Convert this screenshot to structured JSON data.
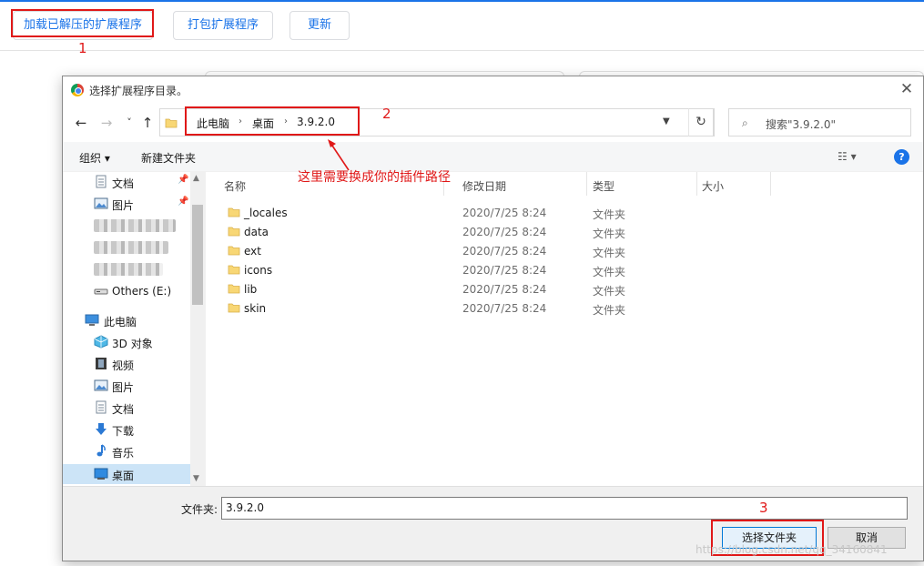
{
  "extensions_toolbar": {
    "load_unpacked": "加载已解压的扩展程序",
    "pack_extension": "打包扩展程序",
    "update": "更新"
  },
  "annotations": {
    "step1": "1",
    "step2": "2",
    "step3": "3",
    "path_note": "这里需要换成你的插件路径"
  },
  "dialog": {
    "title": "选择扩展程序目录。",
    "close": "✕",
    "nav": {
      "back": "←",
      "forward": "→",
      "recent": "˅",
      "up": "↑"
    },
    "breadcrumb": [
      "此电脑",
      "桌面",
      "3.9.2.0"
    ],
    "search_placeholder": "搜索\"3.9.2.0\"",
    "commands": {
      "organize": "组织 ▾",
      "new_folder": "新建文件夹"
    },
    "help": "?"
  },
  "nav_pane": {
    "quick_access": [
      {
        "label": "文档",
        "icon": "document-icon"
      },
      {
        "label": "图片",
        "icon": "picture-icon"
      }
    ],
    "drive": {
      "label": "Others (E:)",
      "icon": "drive-icon"
    },
    "this_pc": {
      "label": "此电脑",
      "icon": "computer-icon"
    },
    "pc_items": [
      {
        "label": "3D 对象",
        "icon": "3d-objects-icon"
      },
      {
        "label": "视频",
        "icon": "video-icon"
      },
      {
        "label": "图片",
        "icon": "picture-icon"
      },
      {
        "label": "文档",
        "icon": "document-icon"
      },
      {
        "label": "下载",
        "icon": "download-icon"
      },
      {
        "label": "音乐",
        "icon": "music-icon"
      },
      {
        "label": "桌面",
        "icon": "desktop-icon",
        "selected": true
      }
    ]
  },
  "file_list": {
    "columns": [
      "名称",
      "修改日期",
      "类型",
      "大小"
    ],
    "rows": [
      {
        "name": "_locales",
        "date": "2020/7/25 8:24",
        "type": "文件夹"
      },
      {
        "name": "data",
        "date": "2020/7/25 8:24",
        "type": "文件夹"
      },
      {
        "name": "ext",
        "date": "2020/7/25 8:24",
        "type": "文件夹"
      },
      {
        "name": "icons",
        "date": "2020/7/25 8:24",
        "type": "文件夹"
      },
      {
        "name": "lib",
        "date": "2020/7/25 8:24",
        "type": "文件夹"
      },
      {
        "name": "skin",
        "date": "2020/7/25 8:24",
        "type": "文件夹"
      }
    ]
  },
  "footer": {
    "folder_label": "文件夹:",
    "folder_value": "3.9.2.0",
    "select_button": "选择文件夹",
    "cancel_button": "取消",
    "watermark": "https://blog.csdn.net/qq_34160841"
  },
  "colors": {
    "accent": "#1a73e8",
    "annotation_red": "#e01818",
    "selection": "#cce4f7",
    "folder_yellow": "#f8d775"
  }
}
